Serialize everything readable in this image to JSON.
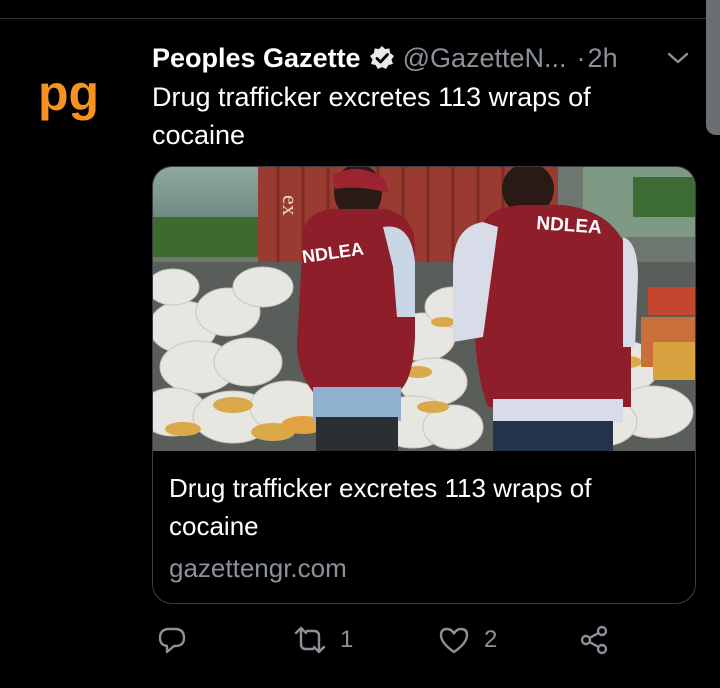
{
  "tweet": {
    "author_name": "Peoples Gazette",
    "handle": "@GazetteN...",
    "separator": "·",
    "time": "2h",
    "text": "Drug trafficker excretes 113 wraps of cocaine",
    "avatar_text": "pg",
    "verified_icon": "verified-badge-icon",
    "more_icon": "chevron-down-icon"
  },
  "card": {
    "title": "Drug trafficker excretes 113 wraps of cocaine",
    "domain": "gazettengr.com",
    "photo_labels": {
      "vest_left": "NDLEA",
      "vest_right": "NDLEA",
      "container_text": "ex"
    }
  },
  "actions": {
    "reply": {
      "icon": "reply-icon",
      "count": ""
    },
    "retweet": {
      "icon": "retweet-icon",
      "count": "1"
    },
    "like": {
      "icon": "heart-icon",
      "count": "2"
    },
    "share": {
      "icon": "share-icon",
      "count": ""
    }
  },
  "colors": {
    "background": "#000000",
    "secondary_text": "#8b9198",
    "brand_orange": "#f7921e",
    "vest_red": "#8e1e2a"
  }
}
